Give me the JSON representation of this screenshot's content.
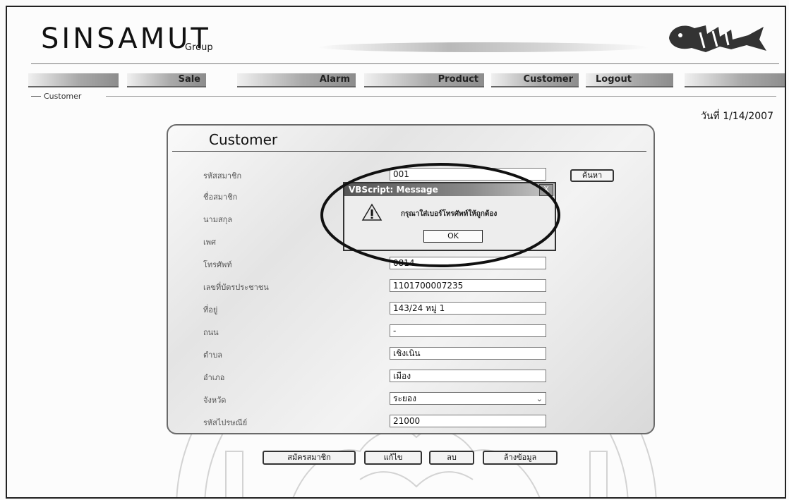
{
  "header": {
    "brand": "SINSAMUT",
    "brand_sub": "Group"
  },
  "nav": {
    "items": [
      "Sale",
      "Alarm",
      "Product",
      "Customer",
      "Logout"
    ]
  },
  "breadcrumb": "Customer",
  "date_text": "วันที่  1/14/2007",
  "form": {
    "title": "Customer",
    "search_label": "ค้นหา",
    "fields": [
      {
        "label": "รหัสสมาชิก",
        "value": "001"
      },
      {
        "label": "ชื่อสมาชิก",
        "value": ""
      },
      {
        "label": "นามสกุล",
        "value": ""
      },
      {
        "label": "เพศ",
        "value": ""
      },
      {
        "label": "โทรศัพท์",
        "value": "0814"
      },
      {
        "label": "เลขที่บัตรประชาชน",
        "value": "1101700007235"
      },
      {
        "label": "ที่อยู่",
        "value": "143/24 หมู่ 1"
      },
      {
        "label": "ถนน",
        "value": "-"
      },
      {
        "label": "ตำบล",
        "value": "เชิงเนิน"
      },
      {
        "label": "อำเภอ",
        "value": "เมือง"
      },
      {
        "label": "จังหวัด",
        "value": "ระยอง"
      },
      {
        "label": "รหัสไปรษณีย์",
        "value": "21000"
      }
    ]
  },
  "buttons": {
    "register": "สมัครสมาชิก",
    "edit": "แก้ไข",
    "delete": "ลบ",
    "clear": "ล้างข้อมูล"
  },
  "dialog": {
    "title": "VBScript: Message",
    "message": "กรุณาใส่เบอร์โทรศัพท์ให้ถูกต้อง",
    "ok_label": "OK",
    "close_glyph": "X",
    "icon": "warning-icon"
  },
  "colors": {
    "panel_border": "#6a6a6a",
    "nav_dark": "#8c8c8c",
    "dialog_bar": "#555555"
  }
}
